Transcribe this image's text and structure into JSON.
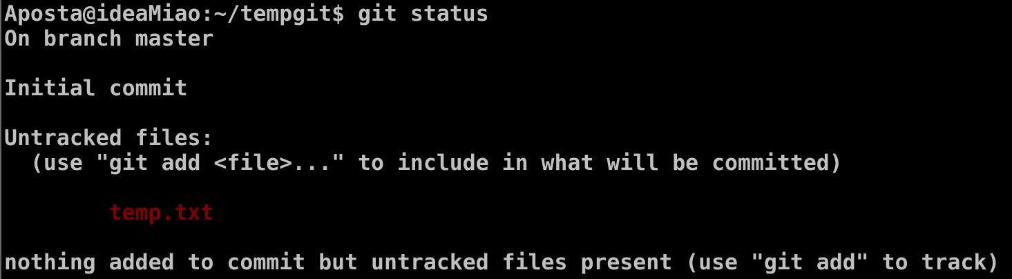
{
  "terminal": {
    "prompt": "Aposta@ideaMiao:~/tempgit$ ",
    "command": "git status",
    "lines": [
      "On branch master",
      "",
      "Initial commit",
      "",
      "Untracked files:",
      "  (use \"git add <file>...\" to include in what will be committed)",
      "",
      "",
      "",
      "nothing added to commit but untracked files present (use \"git add\" to track)"
    ],
    "untracked_indent": "        ",
    "untracked_file": "temp.txt",
    "untracked_file_color": "#800000",
    "text_color": "#c0c0c0",
    "background_color": "#000000"
  }
}
